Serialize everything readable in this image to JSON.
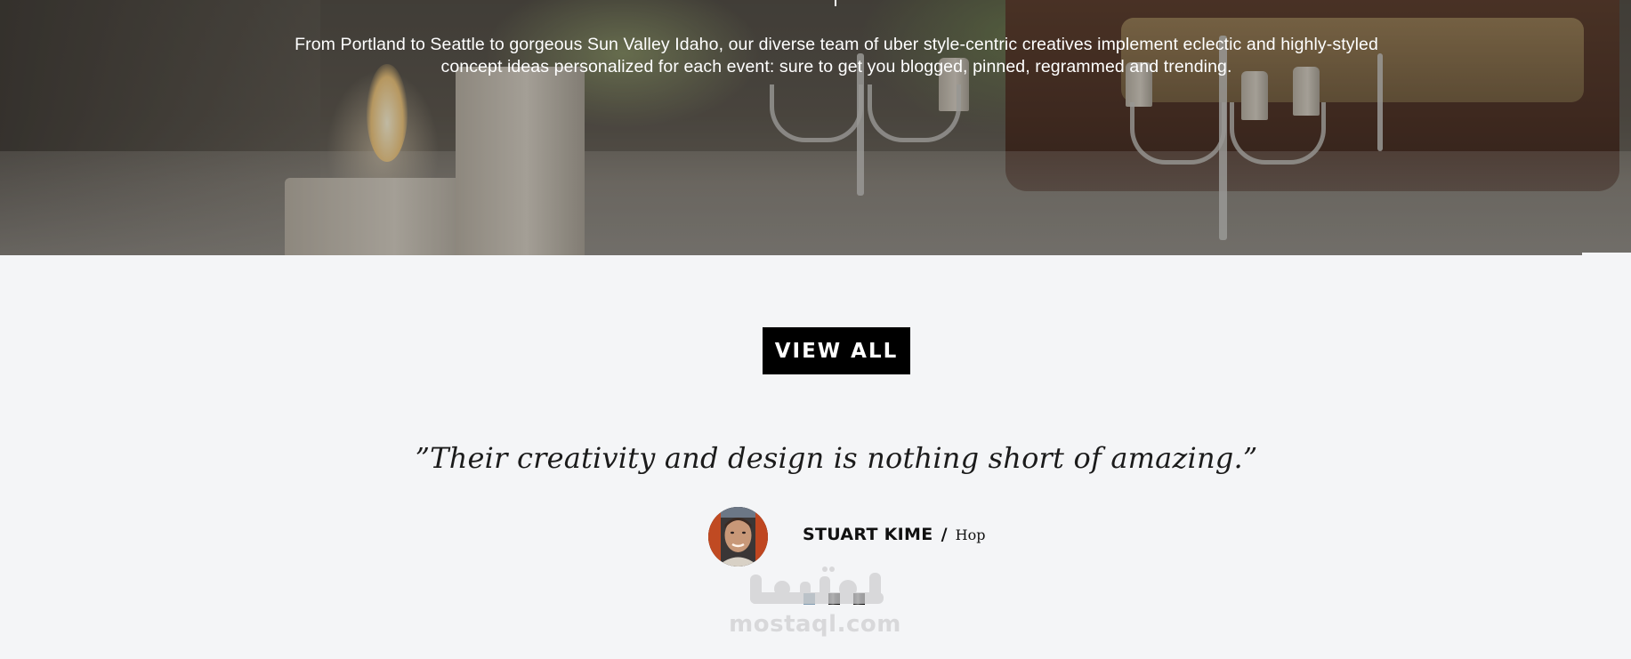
{
  "hero": {
    "description": "From Portland to Seattle to gorgeous Sun Valley Idaho, our diverse team of uber style-centric creatives implement eclectic and highly-styled concept ideas personalized for each event: sure to get you blogged, pinned, regrammed and trending."
  },
  "cta": {
    "view_all_label": "VIEW ALL"
  },
  "testimonial": {
    "quote": "”Their creativity and design is nothing short of amazing.”",
    "author_name": "STUART KIME",
    "separator": "/",
    "author_company": "Hop",
    "slides": [
      {
        "state": "active",
        "color": "#7f9bb0"
      },
      {
        "state": "inactive",
        "color": "#1a1a1a"
      },
      {
        "state": "inactive",
        "color": "#1a1a1a"
      }
    ]
  },
  "watermark": {
    "text": "mostaql.com",
    "logo_text": "مستقل"
  },
  "colors": {
    "background": "#f4f5f7",
    "button": "#000000",
    "button_text": "#ffffff",
    "text": "#111111",
    "hero_text": "#ffffff",
    "active_dot": "#7f9bb0"
  },
  "icons": {
    "avatar": "avatar-photo",
    "pagination": "slider-dot"
  }
}
